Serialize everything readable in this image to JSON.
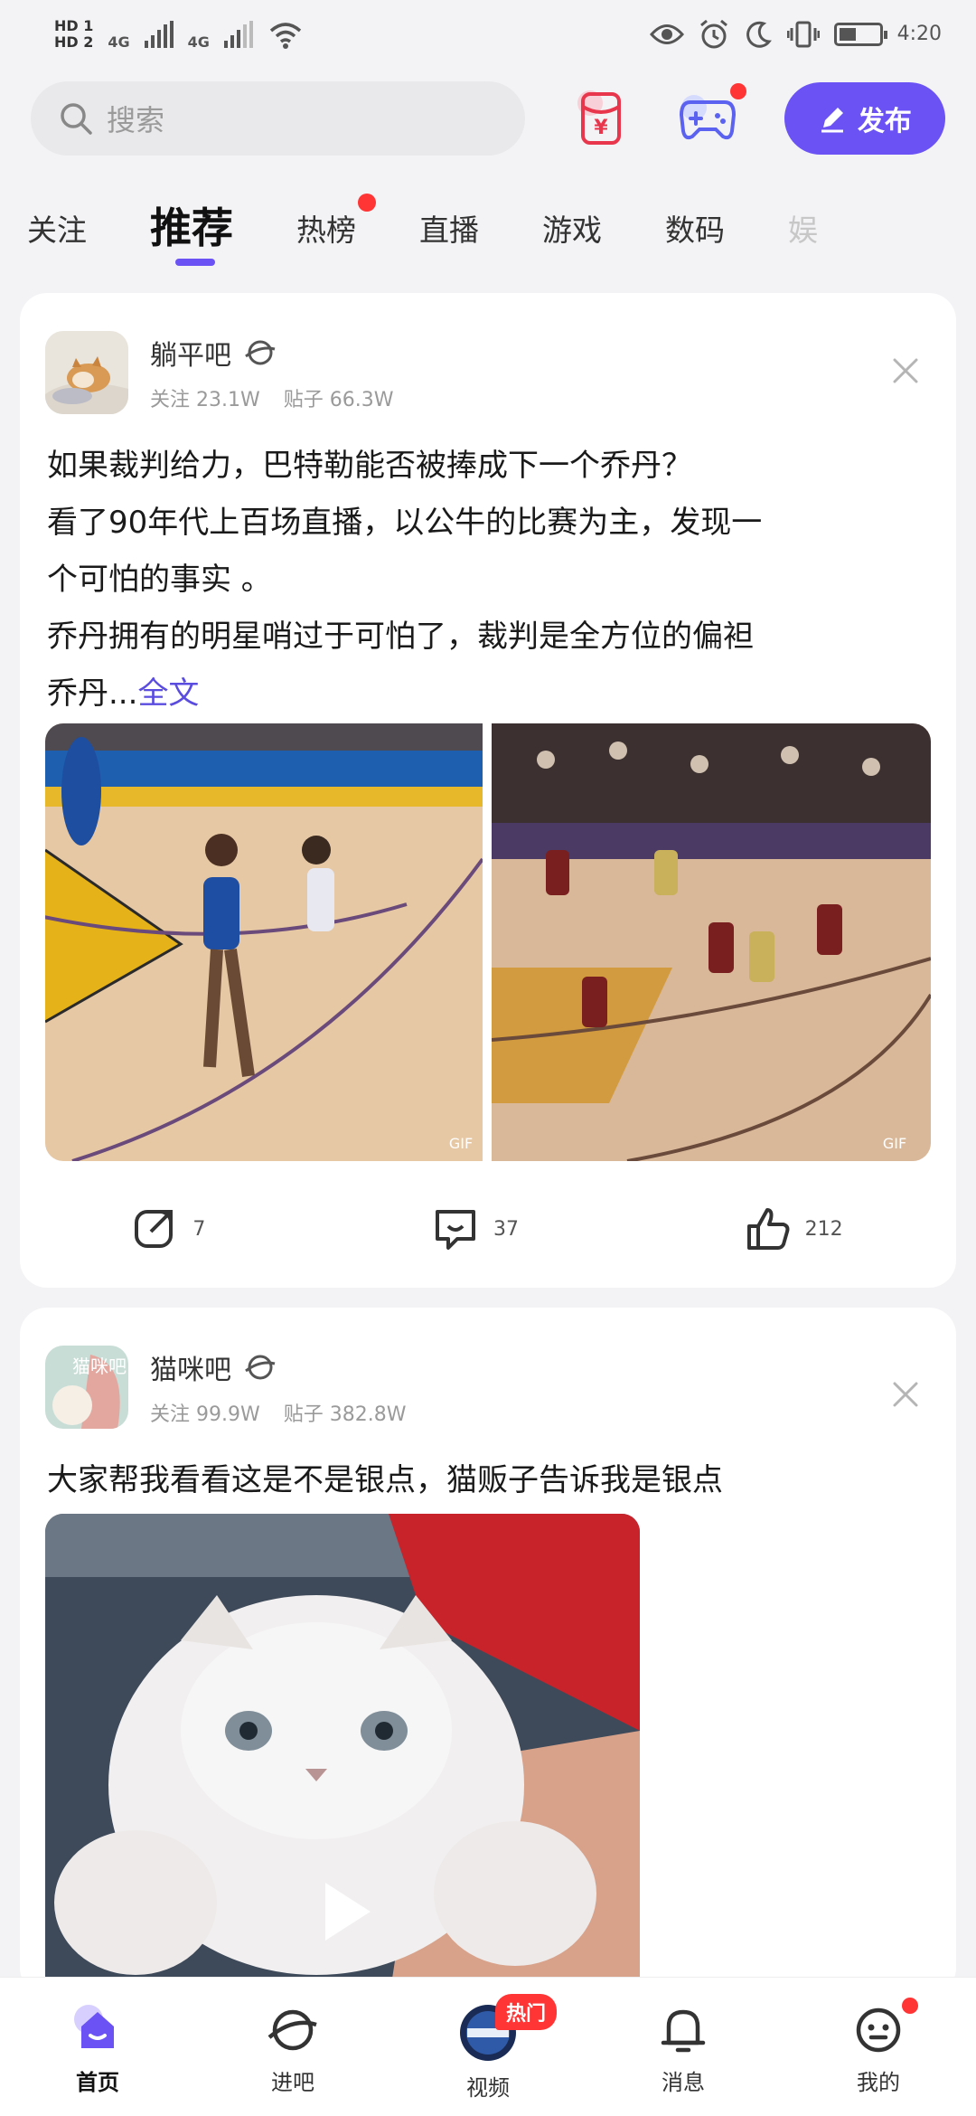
{
  "status_bar": {
    "hd1": "HD 1",
    "hd2": "HD 2",
    "network1": "4G",
    "network2": "4G",
    "time": "4:20"
  },
  "top_bar": {
    "search_placeholder": "搜索",
    "publish_label": "发布",
    "accent_color": "#6a52f5"
  },
  "tabs": [
    {
      "label": "关注"
    },
    {
      "label": "推荐"
    },
    {
      "label": "热榜"
    },
    {
      "label": "直播"
    },
    {
      "label": "游戏"
    },
    {
      "label": "数码"
    },
    {
      "label": "娱"
    }
  ],
  "posts": [
    {
      "forum": "躺平吧",
      "follow_label": "关注",
      "follow_count": "23.1W",
      "posts_label": "贴子",
      "posts_count": "66.3W",
      "text_lines": [
        "如果裁判给力，巴特勒能否被捧成下一个乔丹？",
        "看了90年代上百场直播，以公牛的比赛为主，发现一",
        "个可怕的事实 。",
        "乔丹拥有的明星哨过于可怕了，裁判是全方位的偏袒",
        "乔丹..."
      ],
      "read_more": "全文",
      "image_badges": [
        "GIF",
        "GIF"
      ],
      "shares": "7",
      "comments": "37",
      "likes": "212"
    },
    {
      "forum": "猫咪吧",
      "avatar_text": "猫咪吧",
      "follow_label": "关注",
      "follow_count": "99.9W",
      "posts_label": "贴子",
      "posts_count": "382.8W",
      "text": "大家帮我看看这是不是银点，猫贩子告诉我是银点"
    }
  ],
  "bottom_nav": [
    {
      "label": "首页"
    },
    {
      "label": "进吧"
    },
    {
      "label": "视频",
      "badge": "热门"
    },
    {
      "label": "消息"
    },
    {
      "label": "我的"
    }
  ]
}
